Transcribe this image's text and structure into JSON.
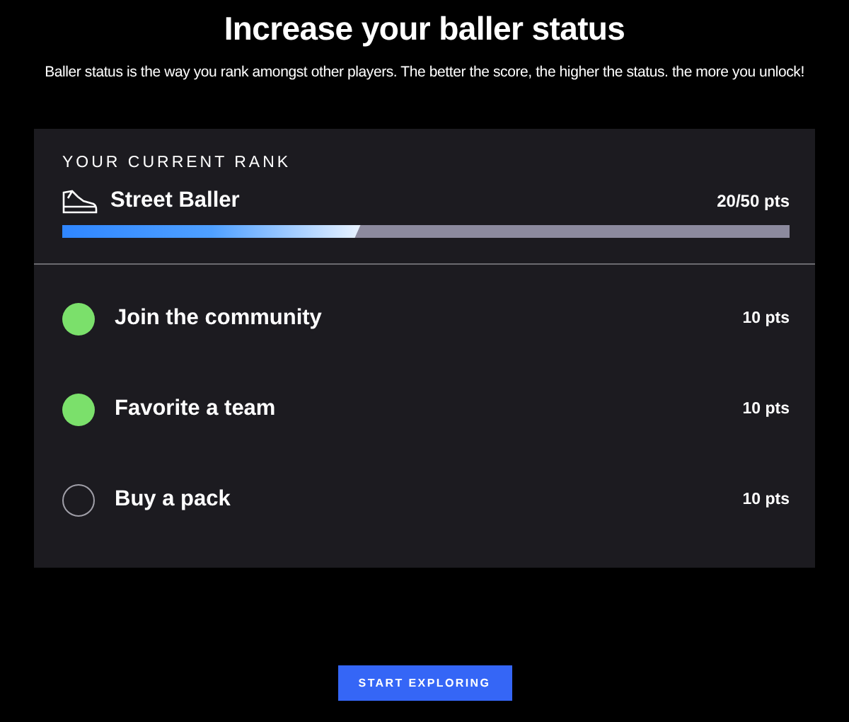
{
  "header": {
    "title": "Increase your baller status",
    "subtitle": "Baller status is the way you rank amongst other players. The better the score, the higher the status. the more you unlock!"
  },
  "rank": {
    "heading": "YOUR CURRENT RANK",
    "name": "Street Baller",
    "points": "20/50 pts",
    "level": 0.41
  },
  "tasks": [
    {
      "label": "Join the community",
      "points": "10 pts",
      "checked": true
    },
    {
      "label": "Favorite a team",
      "points": "10 pts",
      "checked": true
    },
    {
      "label": "Buy a pack",
      "points": "10 pts",
      "checked": false
    }
  ],
  "button": "START EXPLORING"
}
